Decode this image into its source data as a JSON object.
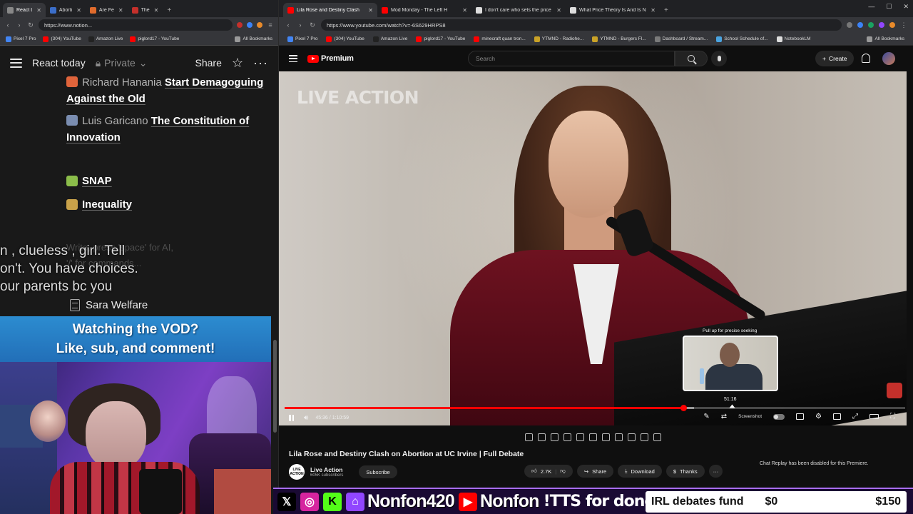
{
  "left_browser": {
    "tabs": [
      {
        "label": "React t",
        "color": "#888888",
        "active": true
      },
      {
        "label": "Aborti",
        "color": "#3b6ec9"
      },
      {
        "label": "Are Fe",
        "color": "#e06b2c"
      },
      {
        "label": "The",
        "color": "#c4302b"
      }
    ],
    "url": "https://www.notion...",
    "bookmarks": [
      {
        "label": "Pixel 7 Pro",
        "color": "#4285f4"
      },
      {
        "label": "(304) YouTube",
        "color": "#ff0000"
      },
      {
        "label": "Amazon Live",
        "color": "#222222"
      },
      {
        "label": "piglord17 - YouTube",
        "color": "#ff0000"
      },
      {
        "label": "All Bookmarks",
        "color": "#999999"
      }
    ]
  },
  "notion": {
    "title": "React today",
    "privacy": "Private",
    "share_label": "Share",
    "entries": [
      {
        "author": "Richard Hanania",
        "title": "Start Demagoguing Against the Old",
        "emoji_color": "#e0643b"
      },
      {
        "author": "Luis Garicano",
        "title": "The Constitution of Innovation",
        "emoji_color": "#7a8db0"
      }
    ],
    "categories": [
      {
        "label": "SNAP",
        "emoji_color": "#8bbd4a"
      },
      {
        "label": "Inequality",
        "emoji_color": "#c9a24a"
      }
    ],
    "placeholder_line1": "Write, press 'space' for AI,",
    "placeholder_line2": "'/' for commands...",
    "page_link": "Sara Welfare"
  },
  "stream_caption": {
    "line1": "n , clueless , girl. Tell",
    "line2": "on't. You have choices.",
    "line3": "our parents bc you"
  },
  "cam_banner": {
    "line1": "Watching the VOD?",
    "line2": "Like, sub, and comment!"
  },
  "right_browser": {
    "tabs": [
      {
        "label": "Lila Rose and Destiny Clash",
        "color": "#ff0000",
        "active": true
      },
      {
        "label": "Mod Monday - The Left H",
        "color": "#ff0000"
      },
      {
        "label": "I don't care who sets the price",
        "color": "#dddddd"
      },
      {
        "label": "What Price Theory Is And Is No",
        "color": "#dddddd"
      }
    ],
    "url": "https://www.youtube.com/watch?v=-6S629HRPS8",
    "bookmarks": [
      {
        "label": "Pixel 7 Pro",
        "color": "#4285f4"
      },
      {
        "label": "(304) YouTube",
        "color": "#ff0000"
      },
      {
        "label": "Amazon Live",
        "color": "#222222"
      },
      {
        "label": "piglord17 - YouTube",
        "color": "#ff0000"
      },
      {
        "label": "minecraft quan tron...",
        "color": "#ff0000"
      },
      {
        "label": "YTMND - Radiohe...",
        "color": "#c9a227"
      },
      {
        "label": "YTMND - Burgers Fl...",
        "color": "#c9a227"
      },
      {
        "label": "Dashboard / Stream...",
        "color": "#7a7a7a"
      },
      {
        "label": "School Schedule of...",
        "color": "#4aa3df"
      },
      {
        "label": "NotebookLM",
        "color": "#dddddd"
      },
      {
        "label": "All Bookmarks",
        "color": "#999999"
      }
    ]
  },
  "youtube": {
    "logo_label": "Premium",
    "search_placeholder": "Search",
    "create_label": "Create",
    "watermark": "LIVE ACTION",
    "preview_hint": "Pull up for precise seeking",
    "preview_time": "51:16",
    "time_current": "45:36",
    "time_total": "1:10:59",
    "played_fraction": 0.642,
    "loaded_fraction": 0.66,
    "screenshot_label": "Screenshot",
    "video_title": "Lila Rose and Destiny Clash on Abortion at UC Irvine | Full Debate",
    "channel_name": "Live Action",
    "channel_avatar_text": "LIVE ACTION",
    "subscribers": "605K subscribers",
    "subscribe_label": "Subscribe",
    "likes": "2.7K",
    "share_label": "Share",
    "download_label": "Download",
    "thanks_label": "Thanks",
    "chat_disabled": "Chat Replay has been disabled for this Premiere."
  },
  "social_bar": {
    "twitch_handle": "Nonfon420",
    "youtube_handle": "Nonfon",
    "tts": "!TTS for dono link",
    "fund_label": "IRL debates fund",
    "fund_current": "$0",
    "fund_goal": "$150",
    "icon_colors": {
      "x": "#000000",
      "instagram": "#d6249f",
      "kick": "#53fc18",
      "twitch": "#9146ff",
      "youtube": "#ff0000"
    }
  }
}
